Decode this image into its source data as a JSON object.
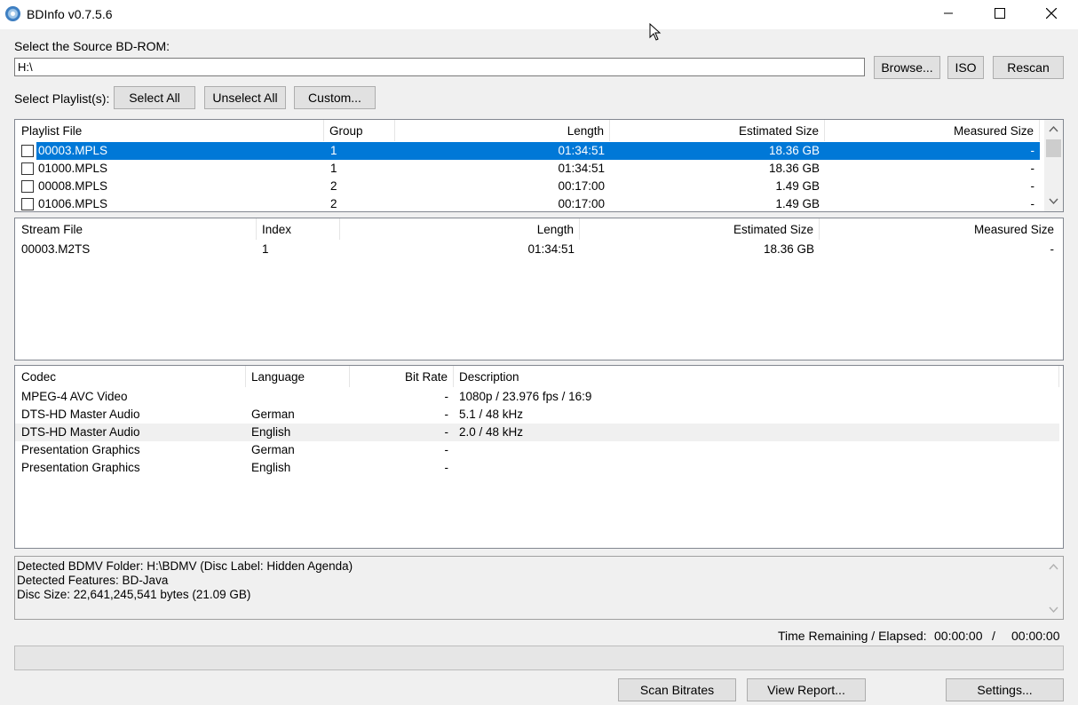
{
  "window": {
    "title": "BDInfo v0.7.5.6"
  },
  "source": {
    "label": "Select the Source BD-ROM:",
    "path": "H:\\"
  },
  "buttons": {
    "browse": "Browse...",
    "iso": "ISO",
    "rescan": "Rescan",
    "select_all": "Select All",
    "unselect_all": "Unselect All",
    "custom": "Custom...",
    "scan_bitrates": "Scan Bitrates",
    "view_report": "View Report...",
    "settings": "Settings..."
  },
  "playlist_label": "Select Playlist(s):",
  "playlists": {
    "headers": [
      "Playlist File",
      "Group",
      "Length",
      "Estimated Size",
      "Measured Size"
    ],
    "rows": [
      {
        "file": "00003.MPLS",
        "group": "1",
        "length": "01:34:51",
        "est": "18.36 GB",
        "meas": "-",
        "selected": true
      },
      {
        "file": "01000.MPLS",
        "group": "1",
        "length": "01:34:51",
        "est": "18.36 GB",
        "meas": "-"
      },
      {
        "file": "00008.MPLS",
        "group": "2",
        "length": "00:17:00",
        "est": "1.49 GB",
        "meas": "-"
      },
      {
        "file": "01006.MPLS",
        "group": "2",
        "length": "00:17:00",
        "est": "1.49 GB",
        "meas": "-"
      }
    ]
  },
  "streams": {
    "headers": [
      "Stream File",
      "Index",
      "Length",
      "Estimated Size",
      "Measured Size"
    ],
    "rows": [
      {
        "file": "00003.M2TS",
        "index": "1",
        "length": "01:34:51",
        "est": "18.36 GB",
        "meas": "-"
      }
    ]
  },
  "codecs": {
    "headers": [
      "Codec",
      "Language",
      "Bit Rate",
      "Description"
    ],
    "rows": [
      {
        "codec": "MPEG-4 AVC Video",
        "lang": "",
        "bitrate": "-",
        "desc": "1080p / 23.976 fps / 16:9"
      },
      {
        "codec": "DTS-HD Master Audio",
        "lang": "German",
        "bitrate": "-",
        "desc": "5.1 / 48 kHz"
      },
      {
        "codec": "DTS-HD Master Audio",
        "lang": "English",
        "bitrate": "-",
        "desc": "2.0 / 48 kHz",
        "highlight": true
      },
      {
        "codec": "Presentation Graphics",
        "lang": "German",
        "bitrate": "-",
        "desc": ""
      },
      {
        "codec": "Presentation Graphics",
        "lang": "English",
        "bitrate": "-",
        "desc": ""
      }
    ]
  },
  "info_lines": [
    "Detected BDMV Folder: H:\\BDMV (Disc Label: Hidden Agenda)",
    "Detected Features: BD-Java",
    "Disc Size: 22,641,245,541 bytes (21.09 GB)"
  ],
  "timing": {
    "label": "Time Remaining / Elapsed:",
    "remaining": "00:00:00",
    "separator": "/",
    "elapsed": "00:00:00"
  },
  "progress": {
    "value": 0
  },
  "colors": {
    "selection": "#0078d7",
    "highlight": "#f0f0f0"
  },
  "icons": {
    "app": "bd-disc-icon",
    "minimize": "minimize-icon",
    "maximize": "maximize-icon",
    "close": "close-icon",
    "scroll_up": "chevron-up-icon",
    "scroll_down": "chevron-down-icon"
  }
}
